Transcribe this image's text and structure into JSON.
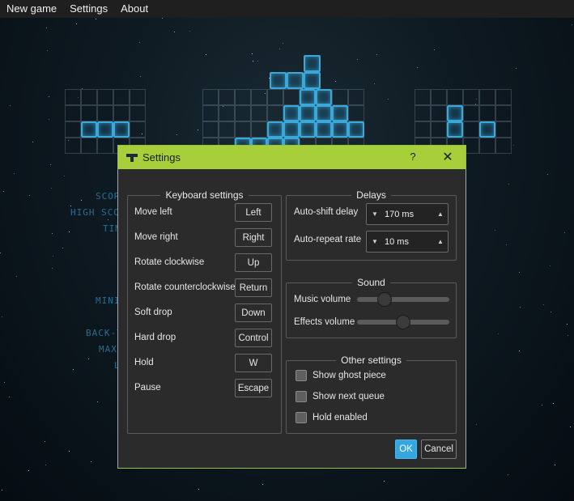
{
  "menu": [
    "New game",
    "Settings",
    "About"
  ],
  "background_labels": [
    "SCORE",
    "HIGH SCORE",
    "TIME",
    "MINI",
    "BACK-T",
    "MAX",
    "L"
  ],
  "dialog": {
    "title": "Settings",
    "help": "?",
    "close": "✕",
    "keyboard": {
      "title": "Keyboard settings",
      "rows": [
        {
          "label": "Move left",
          "key": "Left"
        },
        {
          "label": "Move right",
          "key": "Right"
        },
        {
          "label": "Rotate clockwise",
          "key": "Up"
        },
        {
          "label": "Rotate counterclockwise",
          "key": "Return"
        },
        {
          "label": "Soft drop",
          "key": "Down"
        },
        {
          "label": "Hard drop",
          "key": "Control"
        },
        {
          "label": "Hold",
          "key": "W"
        },
        {
          "label": "Pause",
          "key": "Escape"
        }
      ]
    },
    "delays": {
      "title": "Delays",
      "auto_shift": {
        "label": "Auto-shift delay",
        "value": "170 ms"
      },
      "auto_repeat": {
        "label": "Auto-repeat rate",
        "value": "10 ms"
      }
    },
    "sound": {
      "title": "Sound",
      "music": {
        "label": "Music volume",
        "level": 0.3
      },
      "effects": {
        "label": "Effects volume",
        "level": 0.5
      }
    },
    "other": {
      "title": "Other settings",
      "ghost": {
        "label": "Show ghost piece",
        "checked": false
      },
      "next": {
        "label": "Show next queue",
        "checked": false
      },
      "hold": {
        "label": "Hold enabled",
        "checked": false
      }
    },
    "ok": "OK",
    "cancel": "Cancel"
  }
}
